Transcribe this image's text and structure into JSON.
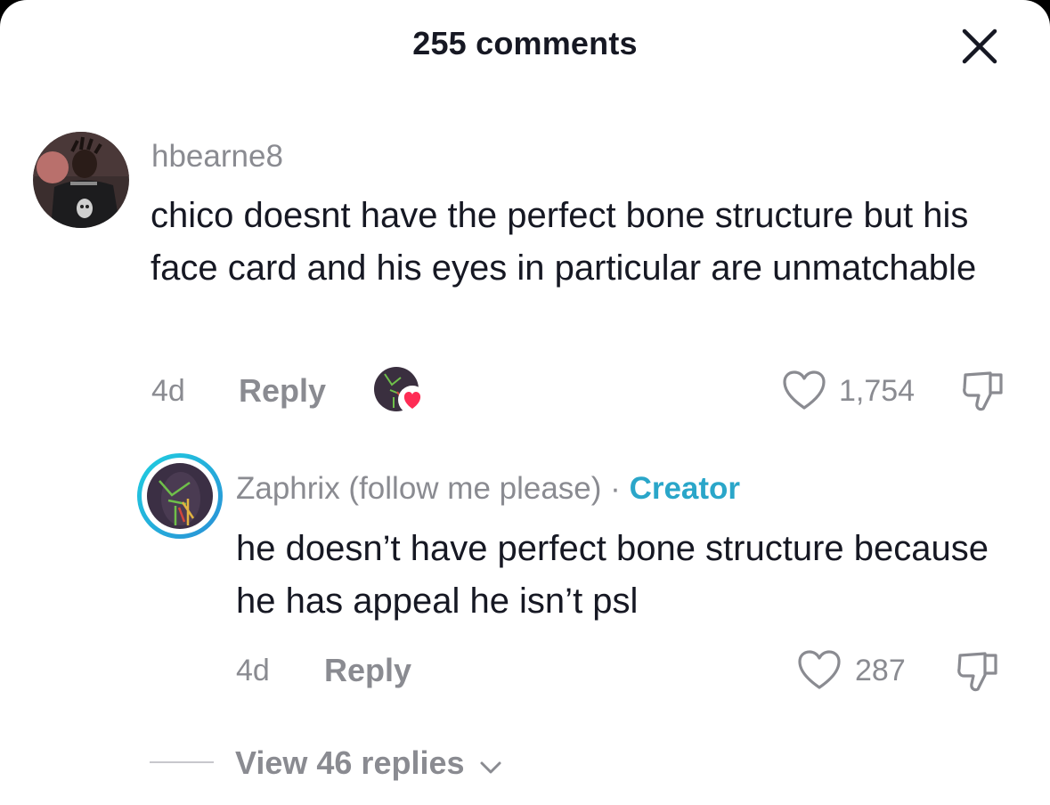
{
  "header": {
    "title": "255 comments",
    "close_icon": "close-icon"
  },
  "comments": [
    {
      "username": "hbearne8",
      "text": "chico doesnt have the perfect bone structure but his face card and his eyes in particular are unmatchable",
      "time": "4d",
      "reply_label": "Reply",
      "likes": "1,754",
      "creator_liked": true
    }
  ],
  "reply": {
    "username": "Zaphrix (follow me please)",
    "separator": "·",
    "badge": "Creator",
    "text": "he doesn’t have perfect bone structure because he has appeal he isn’t psl",
    "time": "4d",
    "reply_label": "Reply",
    "likes": "287"
  },
  "view_replies": {
    "label": "View 46 replies"
  },
  "colors": {
    "creator_accent": "#2aa6c9",
    "heart_red": "#fe2c55",
    "muted_text": "#8a8b91"
  }
}
